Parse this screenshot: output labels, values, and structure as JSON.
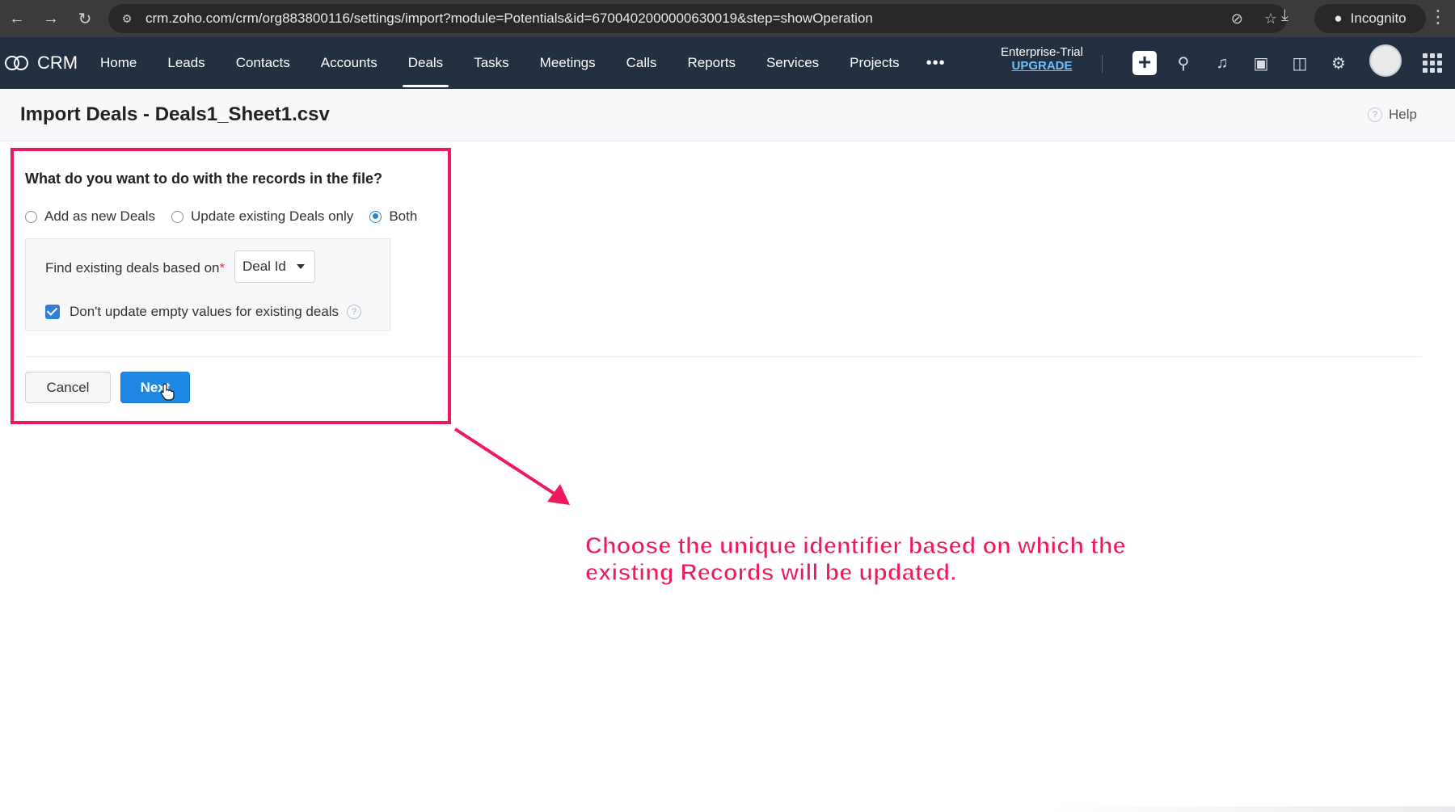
{
  "browser": {
    "url": "crm.zoho.com/crm/org883800116/settings/import?module=Potentials&id=6700402000000630019&step=showOperation",
    "incognito_label": "Incognito"
  },
  "app": {
    "brand": "CRM",
    "nav": [
      "Home",
      "Leads",
      "Contacts",
      "Accounts",
      "Deals",
      "Tasks",
      "Meetings",
      "Calls",
      "Reports",
      "Services",
      "Projects"
    ],
    "active_nav": "Deals",
    "more_label": "•••",
    "trial_label": "Enterprise-Trial",
    "upgrade_label": "UPGRADE"
  },
  "page": {
    "title": "Import Deals - Deals1_Sheet1.csv",
    "help_label": "Help"
  },
  "form": {
    "question": "What do you want to do with the records in the file?",
    "options": [
      {
        "label": "Add as new Deals",
        "checked": false
      },
      {
        "label": "Update existing Deals only",
        "checked": false
      },
      {
        "label": "Both",
        "checked": true
      }
    ],
    "find_label": "Find existing deals based on",
    "required_mark": "*",
    "find_value": "Deal Id",
    "dont_update_label": "Don't update empty values for existing deals",
    "dont_update_checked": true,
    "cancel_label": "Cancel",
    "next_label": "Next"
  },
  "annotation": {
    "line1": "Choose the unique identifier based on which the",
    "line2": "existing Records will be updated.",
    "color": "#f0195a"
  },
  "colors": {
    "nav_bg": "#233042",
    "primary": "#1e88e5",
    "annotation": "#f0195a"
  }
}
